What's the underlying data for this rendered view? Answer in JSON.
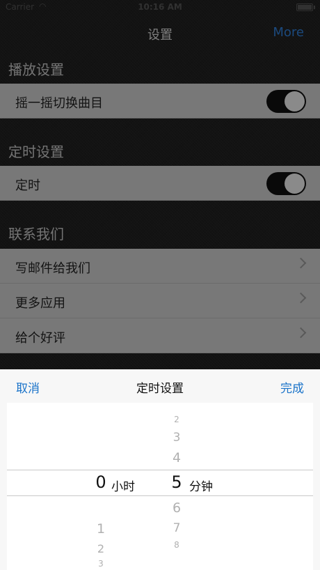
{
  "status": {
    "carrier": "Carrier",
    "time": "10:16 AM"
  },
  "nav": {
    "title": "设置",
    "more_label": "More"
  },
  "sections": {
    "playback": {
      "header": "播放设置",
      "shake_label": "摇一摇切换曲目",
      "shake_on": true
    },
    "timer": {
      "header": "定时设置",
      "timer_label": "定时",
      "timer_on": true
    },
    "contact": {
      "header": "联系我们",
      "items": [
        {
          "label": "写邮件给我们"
        },
        {
          "label": "更多应用"
        },
        {
          "label": "给个好评"
        }
      ]
    }
  },
  "picker": {
    "cancel_label": "取消",
    "title": "定时设置",
    "done_label": "完成",
    "hours": {
      "above": [],
      "selected": "0",
      "below": [
        "1",
        "2",
        "3"
      ],
      "unit": "小时"
    },
    "minutes": {
      "above": [
        "2",
        "3",
        "4"
      ],
      "selected": "5",
      "below": [
        "6",
        "7",
        "8"
      ],
      "unit": "分钟"
    }
  },
  "colors": {
    "accent": "#2f7ed8",
    "row_bg": "#cfcfcf",
    "toggle_on": "#111111"
  }
}
